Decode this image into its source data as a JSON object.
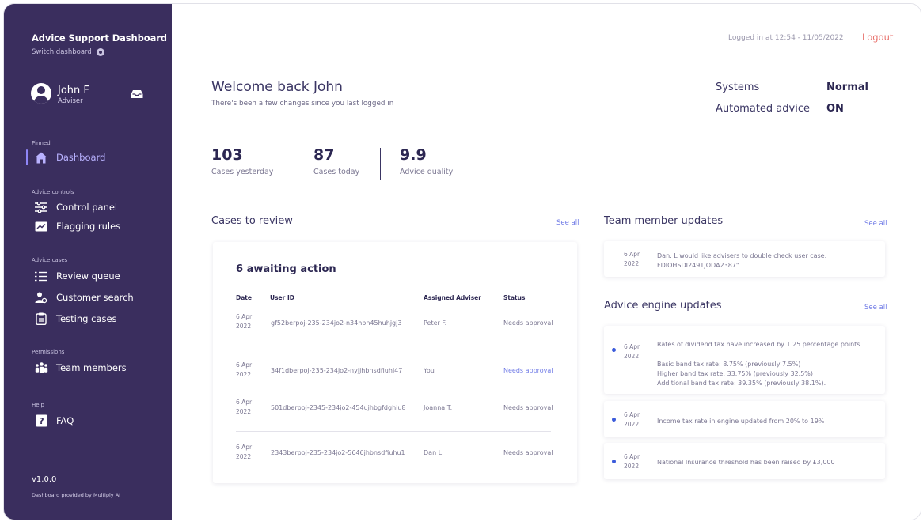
{
  "sidebar": {
    "app_title": "Advice Support Dashboard",
    "switch_label": "Switch dashboard",
    "user": {
      "name": "John F",
      "role": "Adviser"
    },
    "groups": {
      "pinned": "Pinned",
      "advice_controls": "Advice controls",
      "advice_cases": "Advice cases",
      "permissions": "Permissions",
      "help": "Help"
    },
    "items": {
      "dashboard": "Dashboard",
      "control_panel": "Control panel",
      "flagging_rules": "Flagging rules",
      "review_queue": "Review queue",
      "customer_search": "Customer search",
      "testing_cases": "Testing cases",
      "team_members": "Team members",
      "faq": "FAQ"
    },
    "version": "v1.0.0",
    "provided_by": "Dashboard provided by Multiply AI"
  },
  "header": {
    "login_info": "Logged in at 12:54 - 11/05/2022",
    "logout": "Logout"
  },
  "welcome": {
    "title": "Welcome back John",
    "subtitle": "There's been a few changes since you last logged in"
  },
  "systems": {
    "systems_label": "Systems",
    "systems_value": "Normal",
    "automated_label": "Automated advice",
    "automated_value": "ON"
  },
  "stats": [
    {
      "value": "103",
      "label": "Cases yesterday"
    },
    {
      "value": "87",
      "label": "Cases today"
    },
    {
      "value": "9.9",
      "label": "Advice quality"
    }
  ],
  "cases": {
    "title": "Cases to review",
    "see_all": "See all",
    "awaiting": "6 awaiting action",
    "columns": [
      "Date",
      "User ID",
      "Assigned Adviser",
      "Status"
    ],
    "rows": [
      {
        "date_day": "6 Apr",
        "date_year": "2022",
        "user_id": "gf52berpoj-235-234jo2-n34hbn45huhjgj3",
        "adviser": "Peter F.",
        "status": "Needs approval"
      },
      {
        "date_day": "6 Apr",
        "date_year": "2022",
        "user_id": "34f1dberpoj-235-234jo2-nyjjhbnsdfiuhi47",
        "adviser": "You",
        "status": "Needs approval"
      },
      {
        "date_day": "6 Apr",
        "date_year": "2022",
        "user_id": "501dberpoj-2345-234jo2-454ujhbgfdghiu8",
        "adviser": "Joanna T.",
        "status": "Needs approval"
      },
      {
        "date_day": "6 Apr",
        "date_year": "2022",
        "user_id": "2343berpoj-235-234jo2-5646jhbnsdfiuhu1",
        "adviser": "Dan L.",
        "status": "Needs approval"
      }
    ]
  },
  "team_updates": {
    "title": "Team member updates",
    "see_all": "See all",
    "items": [
      {
        "date_day": "6 Apr",
        "date_year": "2022",
        "line1": "Dan. L would like advisers to double check user case:",
        "line2": "FDIOHSDI2491JODA2387\""
      }
    ]
  },
  "engine_updates": {
    "title": "Advice engine updates",
    "see_all": "See all",
    "items": [
      {
        "date_day": "6 Apr",
        "date_year": "2022",
        "line1": "Rates of dividend tax have increased by 1.25 percentage points.",
        "line2": "Basic band tax rate: 8.75% (previously 7.5%)",
        "line3": "Higher band tax rate: 33.75% (previously 32.5%)",
        "line4": "Additional band tax rate: 39.35% (previously 38.1%)."
      },
      {
        "date_day": "6 Apr",
        "date_year": "2022",
        "line1": "Income tax rate in engine updated from 20% to 19%"
      },
      {
        "date_day": "6 Apr",
        "date_year": "2022",
        "line1": "National Insurance threshold has been raised by £3,000"
      }
    ]
  }
}
